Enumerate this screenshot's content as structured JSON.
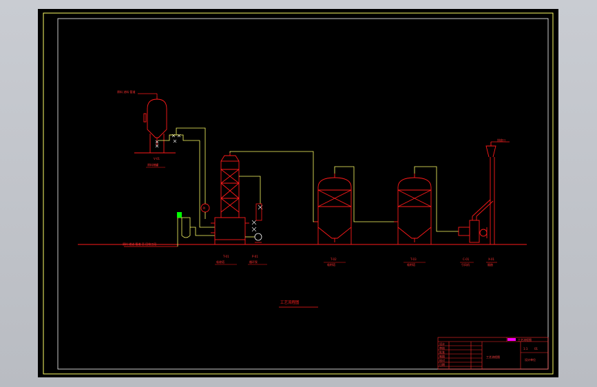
{
  "drawing": {
    "background": "#000000",
    "frame_color": "#ffff66",
    "equipment_color": "#ff1a1a",
    "pipe_color": "#ffff66",
    "marker_color": "#ffffff",
    "accent_color": "#00ff00",
    "title_color": "#ff00ff"
  },
  "labels": {
    "feed_top": "原料 进料 管道",
    "feed_bottom": "原料 输送 管道 至 回收工段",
    "tank_tag": "V-01",
    "tank_name": "原料储罐",
    "col_tag": "T-01",
    "col_name": "吸收塔",
    "pump_tag": "P-01",
    "pump_name": "循环泵",
    "ads1_tag": "T-02",
    "ads1_name": "吸附塔",
    "ads2_tag": "T-03",
    "ads2_name": "吸附塔",
    "fan_tag": "C-01",
    "fan_name": "引风机",
    "stack_tag": "X-01",
    "stack_name": "烟囱",
    "stack_top": "排放口",
    "instrument": "PI",
    "diagram_title": "工艺流程图"
  },
  "title_block": {
    "project": "工艺流程图",
    "sheet_name": "工艺流程图",
    "scale": "1:1",
    "sheet_no": "01",
    "company": "设计单位",
    "rows": [
      "设计",
      "审核",
      "批准",
      "制图",
      "校对",
      "日期"
    ]
  }
}
